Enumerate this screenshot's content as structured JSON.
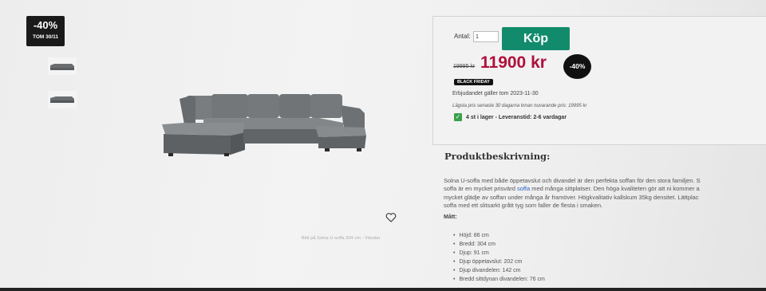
{
  "gallery": {
    "badge_pct": "-40%",
    "badge_until": "TOM 30/11",
    "thumbnails": [
      "sofa-thumbnail",
      "sofa-thumbnail"
    ],
    "caption": "Bild på Solna U-soffa 304 cm - Vänster",
    "heart_icon": "heart-icon"
  },
  "purchase": {
    "qty_label": "Antal:",
    "qty_value": "1",
    "buy_label": "Köp",
    "old_price": "19995 kr",
    "new_price": "11900 kr",
    "round_badge": "-40%",
    "bf_badge": "BLACK FRIDAY",
    "offer_valid": "Erbjudandet gäller tom 2023-11-30",
    "lowest_price": "Lägsta pris senaste 30 dagarna innan nuvarande pris: 19995 kr",
    "stock_icon": "checkmark-icon",
    "stock_text": "4 st i lager - Leveranstid: 2-6 vardagar",
    "colors": {
      "buy_button": "#128b6c",
      "price": "#b0103a",
      "stock": "#3aa14b"
    }
  },
  "description": {
    "title": "Produktbeskrivning:",
    "line1": "Solna U-soffa med både öppetavslut och divandel är den perfekta soffan för den stora familjen. S",
    "line2_before": "soffa är en mycket prisvärd ",
    "line2_link": "soffa",
    "line2_after": " med många sittplatser. Den höga kvaliteten gör att ni kommer a",
    "line3": "mycket glädje av soffan under många år framöver. Högkvalitativ kallskum 35kg densitet. Lättplac",
    "line4": "soffa med ett slitsarkt grått tyg som faller de flesta i smaken.",
    "matt_label": "Mått:",
    "specs": [
      "Höjd: 86 cm",
      "Bredd: 304 cm",
      "Djup: 91 cm",
      "Djup öppetavslut: 202 cm",
      "Djup divandelen: 142 cm",
      "Bredd sittdynan divandelen: 76 cm"
    ]
  }
}
